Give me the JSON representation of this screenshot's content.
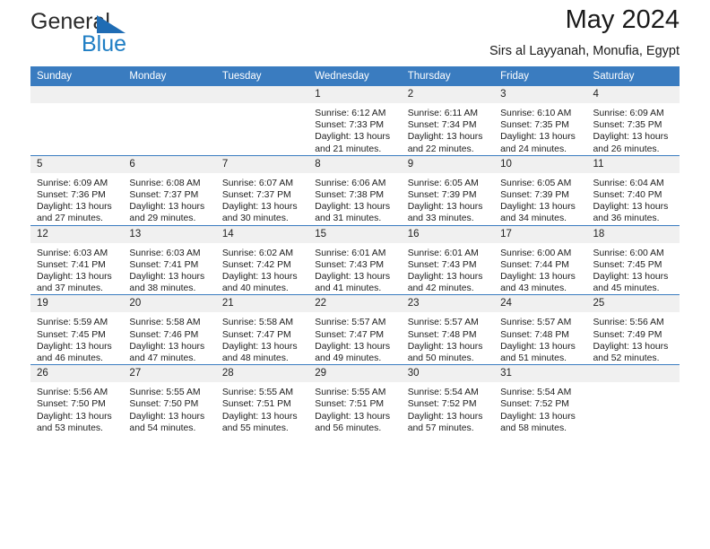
{
  "brand": {
    "name_top": "General",
    "name_bottom": "Blue",
    "accent_color": "#1f7ec4"
  },
  "header": {
    "title": "May 2024",
    "subtitle": "Sirs al Layyanah, Monufia, Egypt"
  },
  "calendar": {
    "header_bg": "#3a7cc0",
    "daynum_bg": "#f0f0f0",
    "weekdays": [
      "Sunday",
      "Monday",
      "Tuesday",
      "Wednesday",
      "Thursday",
      "Friday",
      "Saturday"
    ],
    "weeks": [
      [
        {
          "day": "",
          "empty": true,
          "sunrise": "",
          "sunset": "",
          "daylight_line1": "",
          "daylight_line2": ""
        },
        {
          "day": "",
          "empty": true,
          "sunrise": "",
          "sunset": "",
          "daylight_line1": "",
          "daylight_line2": ""
        },
        {
          "day": "",
          "empty": true,
          "sunrise": "",
          "sunset": "",
          "daylight_line1": "",
          "daylight_line2": ""
        },
        {
          "day": "1",
          "empty": false,
          "sunrise": "Sunrise: 6:12 AM",
          "sunset": "Sunset: 7:33 PM",
          "daylight_line1": "Daylight: 13 hours",
          "daylight_line2": "and 21 minutes."
        },
        {
          "day": "2",
          "empty": false,
          "sunrise": "Sunrise: 6:11 AM",
          "sunset": "Sunset: 7:34 PM",
          "daylight_line1": "Daylight: 13 hours",
          "daylight_line2": "and 22 minutes."
        },
        {
          "day": "3",
          "empty": false,
          "sunrise": "Sunrise: 6:10 AM",
          "sunset": "Sunset: 7:35 PM",
          "daylight_line1": "Daylight: 13 hours",
          "daylight_line2": "and 24 minutes."
        },
        {
          "day": "4",
          "empty": false,
          "sunrise": "Sunrise: 6:09 AM",
          "sunset": "Sunset: 7:35 PM",
          "daylight_line1": "Daylight: 13 hours",
          "daylight_line2": "and 26 minutes."
        }
      ],
      [
        {
          "day": "5",
          "empty": false,
          "sunrise": "Sunrise: 6:09 AM",
          "sunset": "Sunset: 7:36 PM",
          "daylight_line1": "Daylight: 13 hours",
          "daylight_line2": "and 27 minutes."
        },
        {
          "day": "6",
          "empty": false,
          "sunrise": "Sunrise: 6:08 AM",
          "sunset": "Sunset: 7:37 PM",
          "daylight_line1": "Daylight: 13 hours",
          "daylight_line2": "and 29 minutes."
        },
        {
          "day": "7",
          "empty": false,
          "sunrise": "Sunrise: 6:07 AM",
          "sunset": "Sunset: 7:37 PM",
          "daylight_line1": "Daylight: 13 hours",
          "daylight_line2": "and 30 minutes."
        },
        {
          "day": "8",
          "empty": false,
          "sunrise": "Sunrise: 6:06 AM",
          "sunset": "Sunset: 7:38 PM",
          "daylight_line1": "Daylight: 13 hours",
          "daylight_line2": "and 31 minutes."
        },
        {
          "day": "9",
          "empty": false,
          "sunrise": "Sunrise: 6:05 AM",
          "sunset": "Sunset: 7:39 PM",
          "daylight_line1": "Daylight: 13 hours",
          "daylight_line2": "and 33 minutes."
        },
        {
          "day": "10",
          "empty": false,
          "sunrise": "Sunrise: 6:05 AM",
          "sunset": "Sunset: 7:39 PM",
          "daylight_line1": "Daylight: 13 hours",
          "daylight_line2": "and 34 minutes."
        },
        {
          "day": "11",
          "empty": false,
          "sunrise": "Sunrise: 6:04 AM",
          "sunset": "Sunset: 7:40 PM",
          "daylight_line1": "Daylight: 13 hours",
          "daylight_line2": "and 36 minutes."
        }
      ],
      [
        {
          "day": "12",
          "empty": false,
          "sunrise": "Sunrise: 6:03 AM",
          "sunset": "Sunset: 7:41 PM",
          "daylight_line1": "Daylight: 13 hours",
          "daylight_line2": "and 37 minutes."
        },
        {
          "day": "13",
          "empty": false,
          "sunrise": "Sunrise: 6:03 AM",
          "sunset": "Sunset: 7:41 PM",
          "daylight_line1": "Daylight: 13 hours",
          "daylight_line2": "and 38 minutes."
        },
        {
          "day": "14",
          "empty": false,
          "sunrise": "Sunrise: 6:02 AM",
          "sunset": "Sunset: 7:42 PM",
          "daylight_line1": "Daylight: 13 hours",
          "daylight_line2": "and 40 minutes."
        },
        {
          "day": "15",
          "empty": false,
          "sunrise": "Sunrise: 6:01 AM",
          "sunset": "Sunset: 7:43 PM",
          "daylight_line1": "Daylight: 13 hours",
          "daylight_line2": "and 41 minutes."
        },
        {
          "day": "16",
          "empty": false,
          "sunrise": "Sunrise: 6:01 AM",
          "sunset": "Sunset: 7:43 PM",
          "daylight_line1": "Daylight: 13 hours",
          "daylight_line2": "and 42 minutes."
        },
        {
          "day": "17",
          "empty": false,
          "sunrise": "Sunrise: 6:00 AM",
          "sunset": "Sunset: 7:44 PM",
          "daylight_line1": "Daylight: 13 hours",
          "daylight_line2": "and 43 minutes."
        },
        {
          "day": "18",
          "empty": false,
          "sunrise": "Sunrise: 6:00 AM",
          "sunset": "Sunset: 7:45 PM",
          "daylight_line1": "Daylight: 13 hours",
          "daylight_line2": "and 45 minutes."
        }
      ],
      [
        {
          "day": "19",
          "empty": false,
          "sunrise": "Sunrise: 5:59 AM",
          "sunset": "Sunset: 7:45 PM",
          "daylight_line1": "Daylight: 13 hours",
          "daylight_line2": "and 46 minutes."
        },
        {
          "day": "20",
          "empty": false,
          "sunrise": "Sunrise: 5:58 AM",
          "sunset": "Sunset: 7:46 PM",
          "daylight_line1": "Daylight: 13 hours",
          "daylight_line2": "and 47 minutes."
        },
        {
          "day": "21",
          "empty": false,
          "sunrise": "Sunrise: 5:58 AM",
          "sunset": "Sunset: 7:47 PM",
          "daylight_line1": "Daylight: 13 hours",
          "daylight_line2": "and 48 minutes."
        },
        {
          "day": "22",
          "empty": false,
          "sunrise": "Sunrise: 5:57 AM",
          "sunset": "Sunset: 7:47 PM",
          "daylight_line1": "Daylight: 13 hours",
          "daylight_line2": "and 49 minutes."
        },
        {
          "day": "23",
          "empty": false,
          "sunrise": "Sunrise: 5:57 AM",
          "sunset": "Sunset: 7:48 PM",
          "daylight_line1": "Daylight: 13 hours",
          "daylight_line2": "and 50 minutes."
        },
        {
          "day": "24",
          "empty": false,
          "sunrise": "Sunrise: 5:57 AM",
          "sunset": "Sunset: 7:48 PM",
          "daylight_line1": "Daylight: 13 hours",
          "daylight_line2": "and 51 minutes."
        },
        {
          "day": "25",
          "empty": false,
          "sunrise": "Sunrise: 5:56 AM",
          "sunset": "Sunset: 7:49 PM",
          "daylight_line1": "Daylight: 13 hours",
          "daylight_line2": "and 52 minutes."
        }
      ],
      [
        {
          "day": "26",
          "empty": false,
          "sunrise": "Sunrise: 5:56 AM",
          "sunset": "Sunset: 7:50 PM",
          "daylight_line1": "Daylight: 13 hours",
          "daylight_line2": "and 53 minutes."
        },
        {
          "day": "27",
          "empty": false,
          "sunrise": "Sunrise: 5:55 AM",
          "sunset": "Sunset: 7:50 PM",
          "daylight_line1": "Daylight: 13 hours",
          "daylight_line2": "and 54 minutes."
        },
        {
          "day": "28",
          "empty": false,
          "sunrise": "Sunrise: 5:55 AM",
          "sunset": "Sunset: 7:51 PM",
          "daylight_line1": "Daylight: 13 hours",
          "daylight_line2": "and 55 minutes."
        },
        {
          "day": "29",
          "empty": false,
          "sunrise": "Sunrise: 5:55 AM",
          "sunset": "Sunset: 7:51 PM",
          "daylight_line1": "Daylight: 13 hours",
          "daylight_line2": "and 56 minutes."
        },
        {
          "day": "30",
          "empty": false,
          "sunrise": "Sunrise: 5:54 AM",
          "sunset": "Sunset: 7:52 PM",
          "daylight_line1": "Daylight: 13 hours",
          "daylight_line2": "and 57 minutes."
        },
        {
          "day": "31",
          "empty": false,
          "sunrise": "Sunrise: 5:54 AM",
          "sunset": "Sunset: 7:52 PM",
          "daylight_line1": "Daylight: 13 hours",
          "daylight_line2": "and 58 minutes."
        },
        {
          "day": "",
          "empty": true,
          "sunrise": "",
          "sunset": "",
          "daylight_line1": "",
          "daylight_line2": ""
        }
      ]
    ]
  }
}
